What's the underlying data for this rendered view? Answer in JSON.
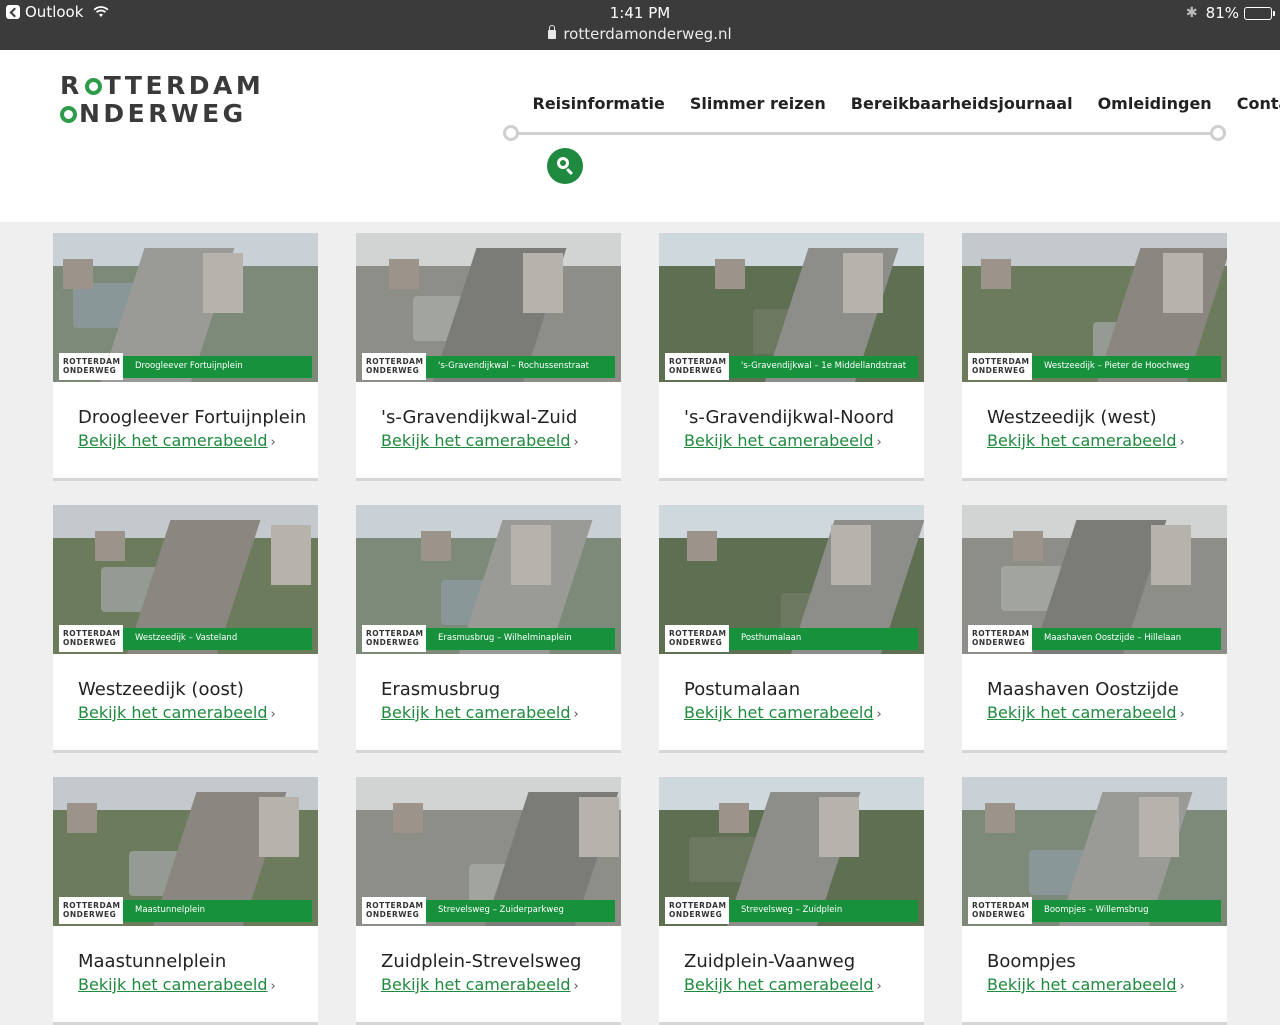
{
  "statusbar": {
    "back_app": "Outlook",
    "time": "1:41 PM",
    "url": "rotterdamonderweg.nl",
    "battery": "81%",
    "battery_level": 0.81
  },
  "logo": {
    "line1": "TTERDAM",
    "line1_prefix": "R",
    "line2": "NDERWEG"
  },
  "nav": {
    "items": [
      "Reisinformatie",
      "Slimmer reizen",
      "Bereikbaarheidsjournaal",
      "Omleidingen",
      "Contact"
    ]
  },
  "cameras": [
    {
      "title": "Droogleever Fortuijnplein",
      "caption": "Droogleever Fortuijnplein",
      "link": "Bekijk het camerabeeld",
      "scene": "river"
    },
    {
      "title": "'s-Gravendijkwal-Zuid",
      "caption": "'s-Gravendijkwal – Rochussenstraat",
      "link": "Bekijk het camerabeeld",
      "scene": "city"
    },
    {
      "title": "'s-Gravendijkwal-Noord",
      "caption": "'s-Gravendijkwal – 1e Middellandstraat",
      "link": "Bekijk het camerabeeld",
      "scene": "street"
    },
    {
      "title": "Westzeedijk (west)",
      "caption": "Westzeedijk – Pieter de Hoochweg",
      "link": "Bekijk het camerabeeld",
      "scene": "aerial"
    },
    {
      "title": "Westzeedijk (oost)",
      "caption": "Westzeedijk – Vasteland",
      "link": "Bekijk het camerabeeld",
      "scene": "aerial"
    },
    {
      "title": "Erasmusbrug",
      "caption": "Erasmusbrug – Wilhelminaplein",
      "link": "Bekijk het camerabeeld",
      "scene": "river"
    },
    {
      "title": "Postumalaan",
      "caption": "Posthumalaan",
      "link": "Bekijk het camerabeeld",
      "scene": "street"
    },
    {
      "title": "Maashaven Oostzijde",
      "caption": "Maashaven Oostzijde – Hillelaan",
      "link": "Bekijk het camerabeeld",
      "scene": "city"
    },
    {
      "title": "Maastunnelplein",
      "caption": "Maastunnelplein",
      "link": "Bekijk het camerabeeld",
      "scene": "aerial"
    },
    {
      "title": "Zuidplein-Strevelsweg",
      "caption": "Strevelsweg – Zuiderparkweg",
      "link": "Bekijk het camerabeeld",
      "scene": "city"
    },
    {
      "title": "Zuidplein-Vaanweg",
      "caption": "Strevelsweg – Zuidplein",
      "link": "Bekijk het camerabeeld",
      "scene": "street"
    },
    {
      "title": "Boompjes",
      "caption": "Boompjes – Willemsbrug",
      "link": "Bekijk het camerabeeld",
      "scene": "river"
    }
  ],
  "colors": {
    "brand_green": "#1f8a3f",
    "status_bar": "#3b3b3b"
  }
}
